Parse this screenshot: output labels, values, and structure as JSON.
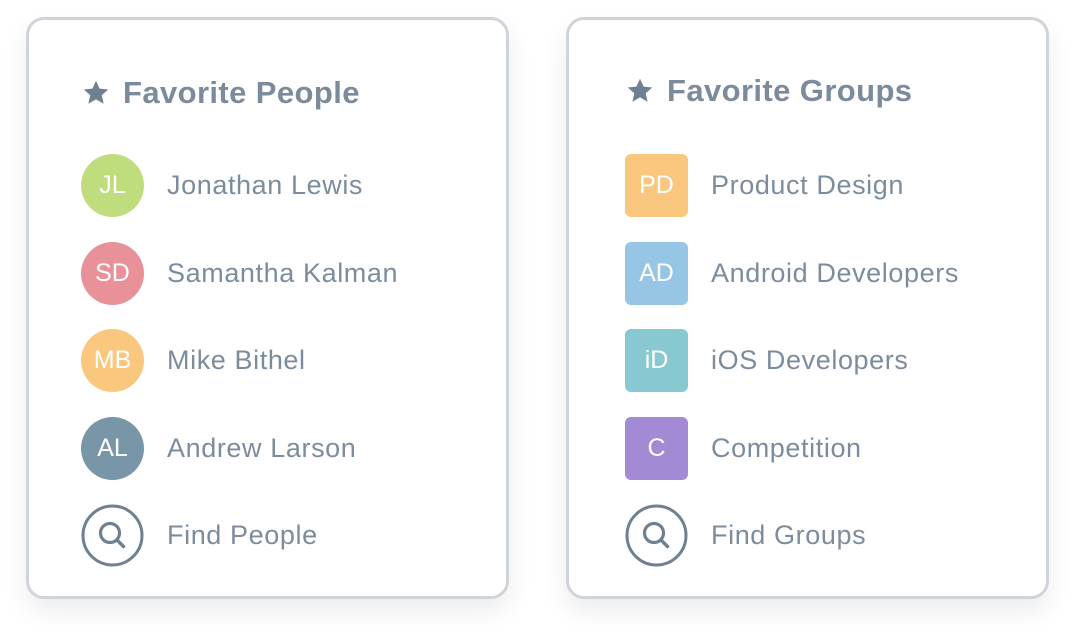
{
  "people": {
    "title": "Favorite People",
    "items": [
      {
        "initials": "JL",
        "name": "Jonathan Lewis",
        "color": "#bfdd7d"
      },
      {
        "initials": "SD",
        "name": "Samantha Kalman",
        "color": "#e99199"
      },
      {
        "initials": "MB",
        "name": "Mike Bithel",
        "color": "#f9c77e"
      },
      {
        "initials": "AL",
        "name": "Andrew Larson",
        "color": "#7896a8"
      }
    ],
    "find_label": "Find People"
  },
  "groups": {
    "title": "Favorite Groups",
    "items": [
      {
        "initials": "PD",
        "name": "Product Design",
        "color": "#f9c77e"
      },
      {
        "initials": "AD",
        "name": "Android Developers",
        "color": "#97c5e6"
      },
      {
        "initials": "iD",
        "name": "iOS Developers",
        "color": "#88c9d1"
      },
      {
        "initials": "C",
        "name": "Competition",
        "color": "#a28bd4"
      }
    ],
    "find_label": "Find Groups"
  },
  "icons": {
    "header": "star-icon",
    "find": "search-icon"
  },
  "colors": {
    "icon": "#6e8092",
    "text": "#7d8c9c",
    "border": "#cfd4da"
  }
}
